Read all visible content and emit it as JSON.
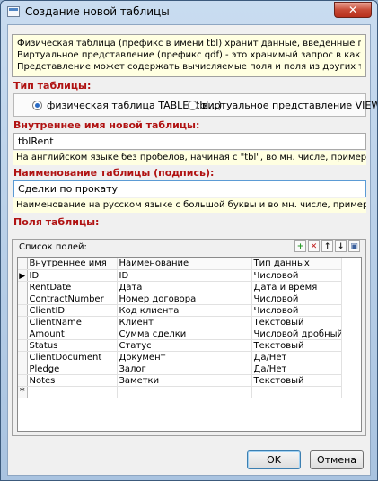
{
  "window": {
    "title": "Создание новой таблицы",
    "close_icon": "close-icon"
  },
  "info": [
    "Физическая таблица (префикс в имени tbl) хранит данные, введенные пользователем.",
    "Виртуальное представление (префикс qdf) - это хранимый запрос в какую-либо таблицу.",
    "Представление может содержать вычисляемые поля и поля из других таблиц."
  ],
  "table_type": {
    "label": "Тип таблицы:",
    "options": [
      {
        "label": "физическая таблица TABLE (tbl...)",
        "selected": true
      },
      {
        "label": "виртуальное представление VIEW (qdf...)",
        "selected": false
      }
    ]
  },
  "internal_name": {
    "label": "Внутреннее имя новой таблицы:",
    "value": "tblRent",
    "hint": "На английском языке без пробелов, начиная с \"tbl\", во мн. числе, пример \"tblMyBooks\""
  },
  "caption": {
    "label": "Наименование таблицы (подпись):",
    "value": "Сделки по прокату",
    "hint": "Наименование на русском языке с большой буквы и во мн. числе, пример \"Мои книги\""
  },
  "fields": {
    "label": "Поля таблицы:",
    "list_caption": "Список полей:",
    "toolbar": [
      "add-icon",
      "delete-icon",
      "move-up-icon",
      "move-down-icon",
      "save-icon"
    ],
    "columns": [
      "Внутреннее имя",
      "Наименование",
      "Тип данных"
    ],
    "rows": [
      [
        "ID",
        "ID",
        "Числовой"
      ],
      [
        "RentDate",
        "Дата",
        "Дата и время"
      ],
      [
        "ContractNumber",
        "Номер договора",
        "Числовой"
      ],
      [
        "ClientID",
        "Код клиента",
        "Числовой"
      ],
      [
        "ClientName",
        "Клиент",
        "Текстовый"
      ],
      [
        "Amount",
        "Сумма сделки",
        "Числовой дробный"
      ],
      [
        "Status",
        "Статус",
        "Текстовый"
      ],
      [
        "ClientDocument",
        "Документ",
        "Да/Нет"
      ],
      [
        "Pledge",
        "Залог",
        "Да/Нет"
      ],
      [
        "Notes",
        "Заметки",
        "Текстовый"
      ]
    ]
  },
  "buttons": {
    "ok": "OK",
    "cancel": "Отмена"
  },
  "colors": {
    "section_label": "#b01212",
    "hint_bg": "#ffffe1",
    "accent": "#2a6bc4"
  }
}
